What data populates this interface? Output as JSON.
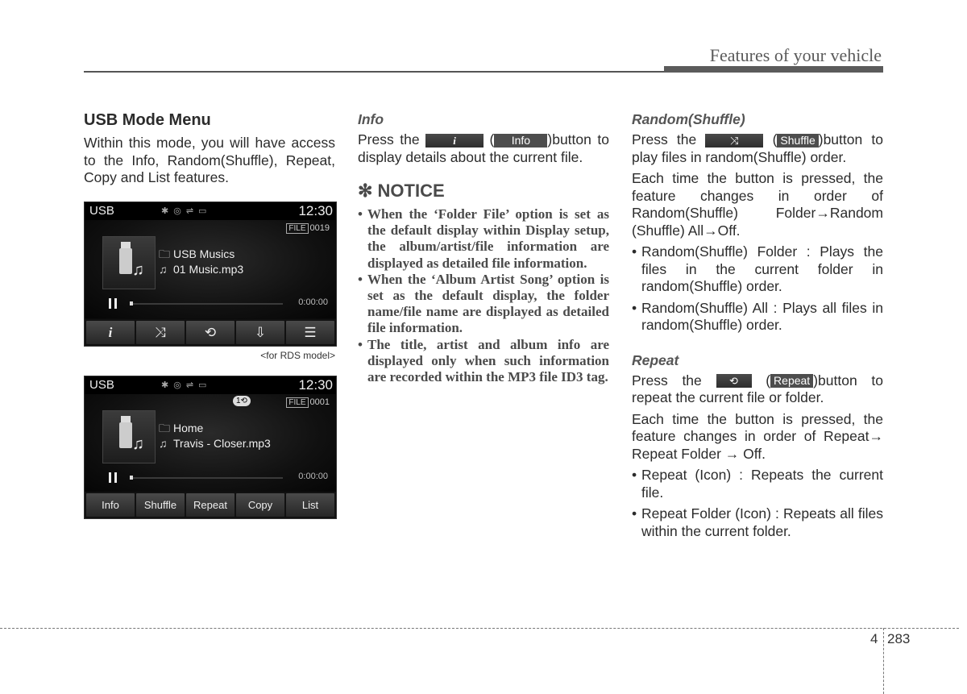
{
  "header": {
    "title": "Features of your vehicle"
  },
  "col1": {
    "heading": "USB Mode Menu",
    "intro": "Within this mode, you will have access to the Info, Random(Shuffle), Repeat, Copy and List features.",
    "caption": "<for RDS model>"
  },
  "screen1": {
    "source": "USB",
    "time": "12:30",
    "status_icons": [
      "bluetooth-icon",
      "disc-icon",
      "usb-icon",
      "aux-icon"
    ],
    "file_tag": "FILE",
    "file_number": "0019",
    "folder": "USB Musics",
    "track": "01 Music.mp3",
    "elapsed": "0:00:00",
    "progress": 0,
    "buttons": [
      {
        "name": "info",
        "glyph": "i"
      },
      {
        "name": "shuffle",
        "glyph": "⤨"
      },
      {
        "name": "repeat",
        "glyph": "⟲"
      },
      {
        "name": "copy",
        "glyph": "⇩"
      },
      {
        "name": "list",
        "glyph": "☰"
      }
    ]
  },
  "screen2": {
    "source": "USB",
    "time": "12:30",
    "repeat_indicator": "1⟲",
    "file_tag": "FILE",
    "file_number": "0001",
    "folder": "Home",
    "track": "Travis - Closer.mp3",
    "elapsed": "0:00:00",
    "progress": 0,
    "buttons": [
      {
        "name": "info",
        "label": "Info"
      },
      {
        "name": "shuffle",
        "label": "Shuffle"
      },
      {
        "name": "repeat",
        "label": "Repeat"
      },
      {
        "name": "copy",
        "label": "Copy"
      },
      {
        "name": "list",
        "label": "List"
      }
    ]
  },
  "col2": {
    "info_heading": "Info",
    "info_pre": "Press the",
    "info_icon_glyph": "i",
    "info_label": "Info",
    "info_post": ")button to display details about the current file.",
    "notice_heading": "✻ NOTICE",
    "notice_items": [
      "When the ‘Folder File’ option is set as the default display within Display setup, the album/artist/file information are displayed as detailed file information.",
      "When the ‘Album Artist Song’ option is set as the default display, the folder name/file name are displayed as detailed file information.",
      "The title, artist and album info are displayed only when such information are recorded within the MP3 file ID3 tag."
    ]
  },
  "col3": {
    "shuffle_heading": "Random(Shuffle)",
    "shuffle_pre": "Press the",
    "shuffle_icon_glyph": "⤨",
    "shuffle_label": "Shuffle",
    "shuffle_post": ")button to play files in random(Shuffle) order.",
    "shuffle_cycle": "Each time the button is pressed, the feature changes in order of Random(Shuffle) Folder→Random (Shuffle) All→Off.",
    "shuffle_items": [
      "Random(Shuffle) Folder : Plays the files in the current folder in random(Shuffle) order.",
      "Random(Shuffle) All : Plays all files in random(Shuffle) order."
    ],
    "repeat_heading": "Repeat",
    "repeat_pre": "Press the",
    "repeat_icon_glyph": "⟲",
    "repeat_label": "Repeat",
    "repeat_post": ")button to repeat the current file or folder.",
    "repeat_cycle": "Each time the button is pressed, the feature changes in order of Repeat→ Repeat Folder → Off.",
    "repeat_items": [
      "Repeat (Icon) : Repeats the current file.",
      "Repeat Folder (Icon) : Repeats all files within the current folder."
    ]
  },
  "footer": {
    "chapter": "4",
    "page": "283"
  }
}
